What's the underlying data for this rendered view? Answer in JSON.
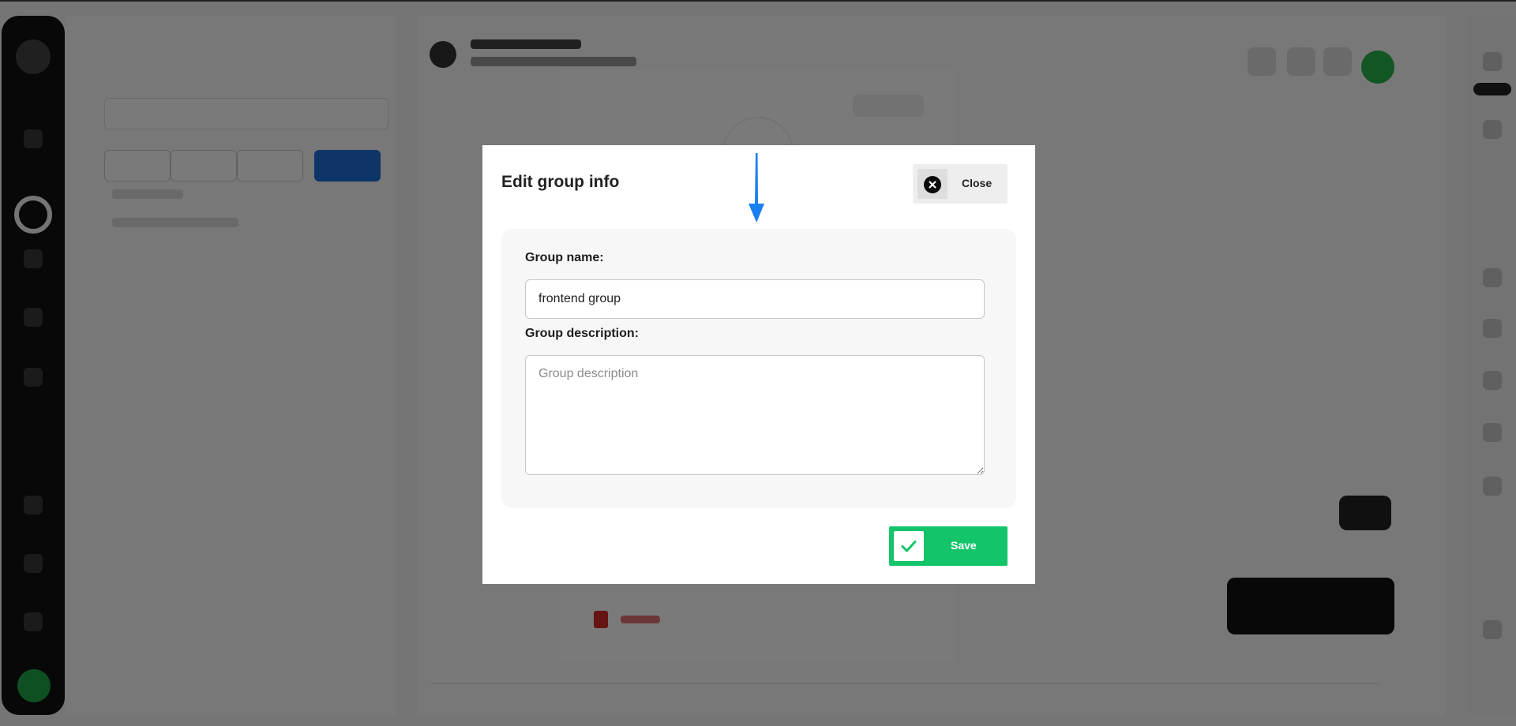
{
  "modal": {
    "title": "Edit group info",
    "close_label": "Close",
    "name_label": "Group name:",
    "name_value": "frontend group",
    "description_label": "Group description:",
    "description_placeholder": "Group description",
    "save_label": "Save"
  },
  "colors": {
    "save_green": "#14c46a",
    "arrow_blue": "#1a7ff0",
    "overlay": "rgba(0,0,0,0.52)"
  }
}
